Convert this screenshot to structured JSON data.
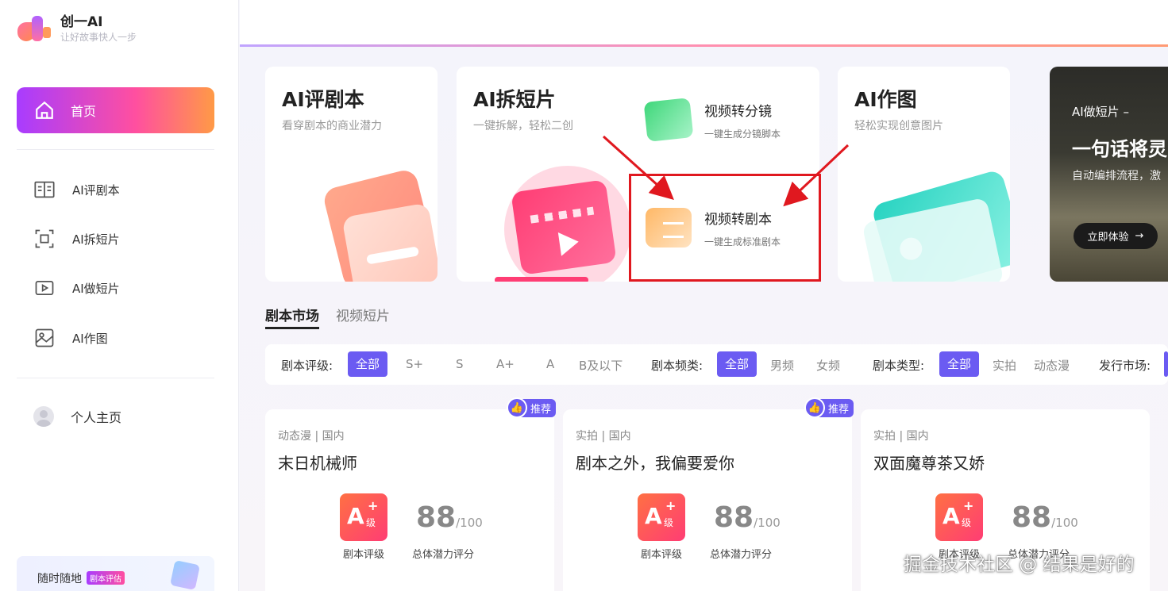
{
  "brand": {
    "name": "创一AI",
    "slogan": "让好故事快人一步"
  },
  "sidebar": {
    "home": "首页",
    "items": [
      {
        "label": "AI评剧本",
        "icon": "book-icon"
      },
      {
        "label": "AI拆短片",
        "icon": "split-icon"
      },
      {
        "label": "AI做短片",
        "icon": "video-icon"
      },
      {
        "label": "AI作图",
        "icon": "image-icon"
      }
    ],
    "profile": "个人主页",
    "promo": {
      "text": "随时随地",
      "tag": "剧本评估"
    }
  },
  "features": {
    "review": {
      "title": "AI评剧本",
      "subtitle": "看穿剧本的商业潜力"
    },
    "split": {
      "title": "AI拆短片",
      "subtitle": "一键拆解，轻松二创"
    },
    "storyboard": {
      "title": "视频转分镜",
      "subtitle": "一键生成分镜脚本"
    },
    "script": {
      "title": "视频转剧本",
      "subtitle": "一键生成标准剧本"
    },
    "draw": {
      "title": "AI作图",
      "subtitle": "轻松实现创意图片"
    }
  },
  "banner": {
    "line1": "AI做短片 –",
    "line2": "一句话将灵",
    "line3": "自动编排流程，激",
    "button": "立即体验"
  },
  "tabs": [
    "剧本市场",
    "视频短片"
  ],
  "filters": {
    "rating_label": "剧本评级:",
    "rating": [
      "全部",
      "S+",
      "S",
      "A+",
      "A",
      "B及以下"
    ],
    "channel_label": "剧本频类:",
    "channel": [
      "全部",
      "男频",
      "女频"
    ],
    "type_label": "剧本类型:",
    "type": [
      "全部",
      "实拍",
      "动态漫"
    ],
    "market_label": "发行市场:"
  },
  "scripts": [
    {
      "category": "动态漫 | 国内",
      "title": "末日机械师",
      "grade": "A",
      "grade_suffix": "级",
      "score": "88",
      "score_max": "/100",
      "grade_label": "剧本评级",
      "score_label": "总体潜力评分",
      "recommended": true
    },
    {
      "category": "实拍 | 国内",
      "title": "剧本之外，我偏要爱你",
      "grade": "A",
      "grade_suffix": "级",
      "score": "88",
      "score_max": "/100",
      "grade_label": "剧本评级",
      "score_label": "总体潜力评分",
      "recommended": true
    },
    {
      "category": "实拍 | 国内",
      "title": "双面魔尊茶又娇",
      "grade": "A",
      "grade_suffix": "级",
      "score": "88",
      "score_max": "/100",
      "grade_label": "剧本评级",
      "score_label": "总体潜力评分",
      "recommended": false
    }
  ],
  "recommend_label": "推荐",
  "watermark": "掘金技术社区 @ 结果是好的",
  "colors": {
    "accent": "#6b5bf2",
    "highlight": "#e0181f",
    "brand_gradient_start": "#a83cff",
    "brand_gradient_end": "#ff9a46"
  }
}
